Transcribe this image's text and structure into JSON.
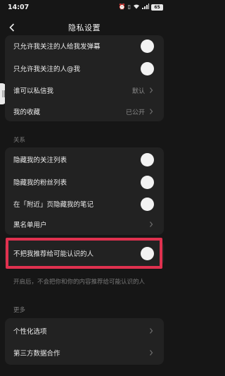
{
  "status_bar": {
    "time": "14:07",
    "icons": [
      "alarm-icon",
      "vibrate-icon",
      "wifi-icon",
      "signal-icon"
    ],
    "battery": "65"
  },
  "header": {
    "title": "隐私设置",
    "back_icon": "chevron-left-icon"
  },
  "top_group": {
    "items": [
      {
        "label": "只允许我关注的人给我发弹幕",
        "type": "toggle"
      },
      {
        "label": "只允许我关注的人@我",
        "type": "toggle"
      },
      {
        "label": "谁可以私信我",
        "type": "select",
        "value": "默认"
      },
      {
        "label": "我的收藏",
        "type": "select",
        "value": "已公开"
      }
    ]
  },
  "relations": {
    "header": "关系",
    "items": [
      {
        "label": "隐藏我的关注列表",
        "type": "toggle"
      },
      {
        "label": "隐藏我的粉丝列表",
        "type": "toggle"
      },
      {
        "label": "在「附近」页隐藏我的笔记",
        "type": "toggle"
      },
      {
        "label": "黑名单用户",
        "type": "link"
      }
    ]
  },
  "recommend": {
    "label": "不把我推荐给可能认识的人",
    "type": "toggle",
    "hint": "开启后，不会把你和你的内容推荐给可能认识的人"
  },
  "more": {
    "header": "更多",
    "items": [
      {
        "label": "个性化选项",
        "type": "link"
      },
      {
        "label": "第三方数据合作",
        "type": "link"
      }
    ]
  },
  "colors": {
    "background": "#161616",
    "card": "#222222",
    "highlight": "#e0314f"
  }
}
